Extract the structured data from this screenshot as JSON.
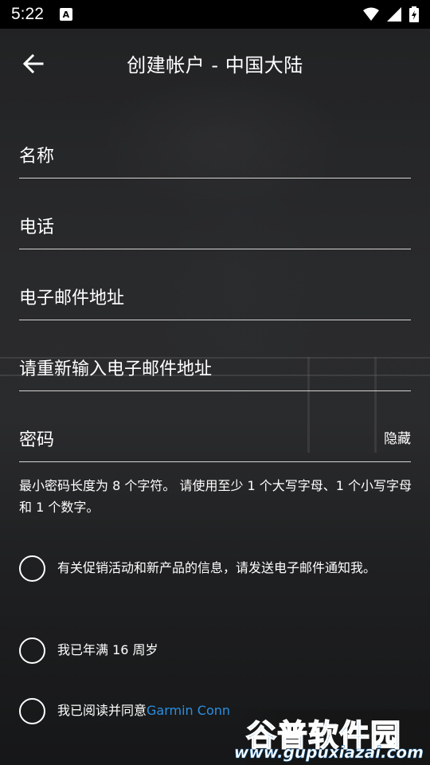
{
  "status_bar": {
    "time": "5:22",
    "notification_icon_letter": "A",
    "icons": [
      "wifi-icon",
      "cell-signal-icon",
      "battery-charging-icon"
    ]
  },
  "app_bar": {
    "title": "创建帐户 - 中国大陆",
    "back_icon": "arrow-left-icon"
  },
  "form": {
    "name_placeholder": "名称",
    "phone_placeholder": "电话",
    "email_placeholder": "电子邮件地址",
    "email_confirm_placeholder": "请重新输入电子邮件地址",
    "password_placeholder": "密码",
    "password_toggle_label": "隐藏",
    "password_hint": "最小密码长度为 8 个字符。 请使用至少 1 个大写字母、1 个小写字母和 1 个数字。"
  },
  "options": {
    "promo_label": "有关促销活动和新产品的信息，请发送电子邮件通知我。",
    "age_label": "我已年满 16 周岁",
    "terms_prefix": "我已阅读并同意",
    "terms_link": "Garmin Conn"
  },
  "watermark": {
    "title": "谷普软件园",
    "url": "www.gupuxiazai.com"
  },
  "colors": {
    "link": "#2a8fe3",
    "status_bar_bg": "#000000",
    "watermark_blue": "#1e6fb4"
  }
}
